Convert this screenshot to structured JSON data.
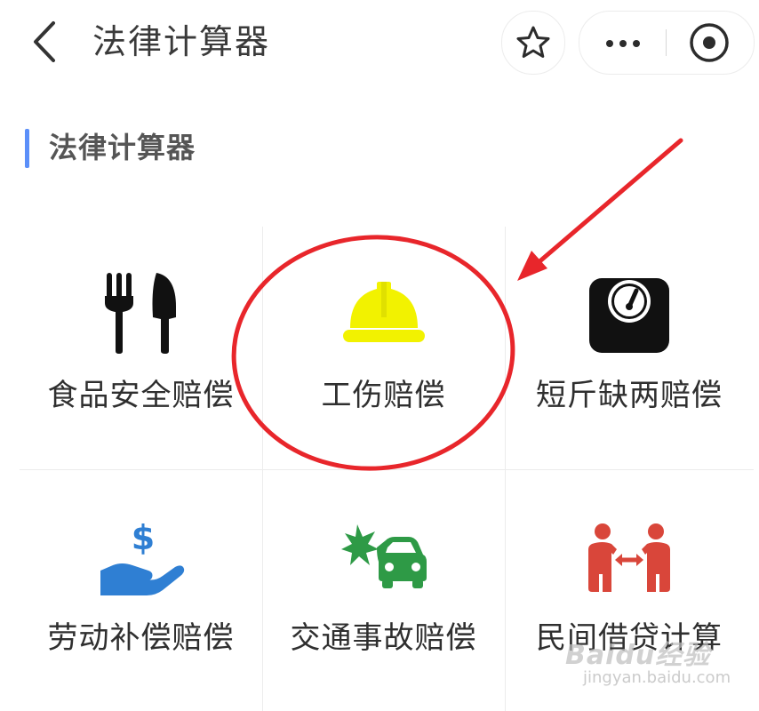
{
  "nav": {
    "title": "法律计算器"
  },
  "section": {
    "title": "法律计算器"
  },
  "items": [
    {
      "label": "食品安全赔偿",
      "icon": "fork-knife-icon",
      "color": "#111111"
    },
    {
      "label": "工伤赔偿",
      "icon": "hard-hat-icon",
      "color": "#f2f200"
    },
    {
      "label": "短斤缺两赔偿",
      "icon": "weighing-scale-icon",
      "color": "#111111"
    },
    {
      "label": "劳动补偿赔偿",
      "icon": "hand-dollar-icon",
      "color": "#2f7fd3"
    },
    {
      "label": "交通事故赔偿",
      "icon": "car-crash-icon",
      "color": "#2e9a46"
    },
    {
      "label": "民间借贷计算",
      "icon": "people-exchange-icon",
      "color": "#d9463a"
    }
  ],
  "annotation": {
    "highlight_color": "#e8262b"
  },
  "watermark": {
    "brand": "Baidu经验",
    "url": "jingyan.baidu.com"
  }
}
